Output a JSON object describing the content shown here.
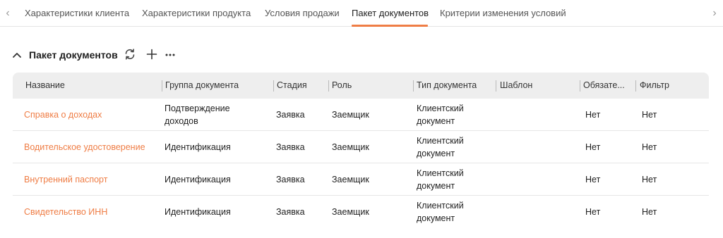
{
  "tabs": [
    {
      "label": "Характеристики клиента"
    },
    {
      "label": "Характеристики продукта"
    },
    {
      "label": "Условия продажи"
    },
    {
      "label": "Пакет документов"
    },
    {
      "label": "Критерии изменения условий"
    }
  ],
  "active_tab": "Пакет документов",
  "accent_color": "#ef7d45",
  "icons": {
    "scroll_left": "chevron-left-icon",
    "scroll_right": "chevron-right-icon",
    "collapse": "chevron-up-icon",
    "refresh": "refresh-icon",
    "add": "plus-icon",
    "more": "more-dots-icon"
  },
  "section": {
    "title": "Пакет документов"
  },
  "table": {
    "headers": [
      "Название",
      "Группа документа",
      "Стадия",
      "Роль",
      "Тип документа",
      "Шаблон",
      "Обязате...",
      "Фильтр"
    ],
    "rows": [
      {
        "name": "Справка о доходах",
        "group": "Подтверждение доходов",
        "stage": "Заявка",
        "role": "Заемщик",
        "type": "Клиентский документ",
        "template": "",
        "required": "Нет",
        "filter": "Нет"
      },
      {
        "name": "Водительское удостоверение",
        "group": "Идентификация",
        "stage": "Заявка",
        "role": "Заемщик",
        "type": "Клиентский документ",
        "template": "",
        "required": "Нет",
        "filter": "Нет"
      },
      {
        "name": "Внутренний паспорт",
        "group": "Идентификация",
        "stage": "Заявка",
        "role": "Заемщик",
        "type": "Клиентский документ",
        "template": "",
        "required": "Нет",
        "filter": "Нет"
      },
      {
        "name": "Свидетельство ИНН",
        "group": "Идентификация",
        "stage": "Заявка",
        "role": "Заемщик",
        "type": "Клиентский документ",
        "template": "",
        "required": "Нет",
        "filter": "Нет"
      }
    ]
  }
}
